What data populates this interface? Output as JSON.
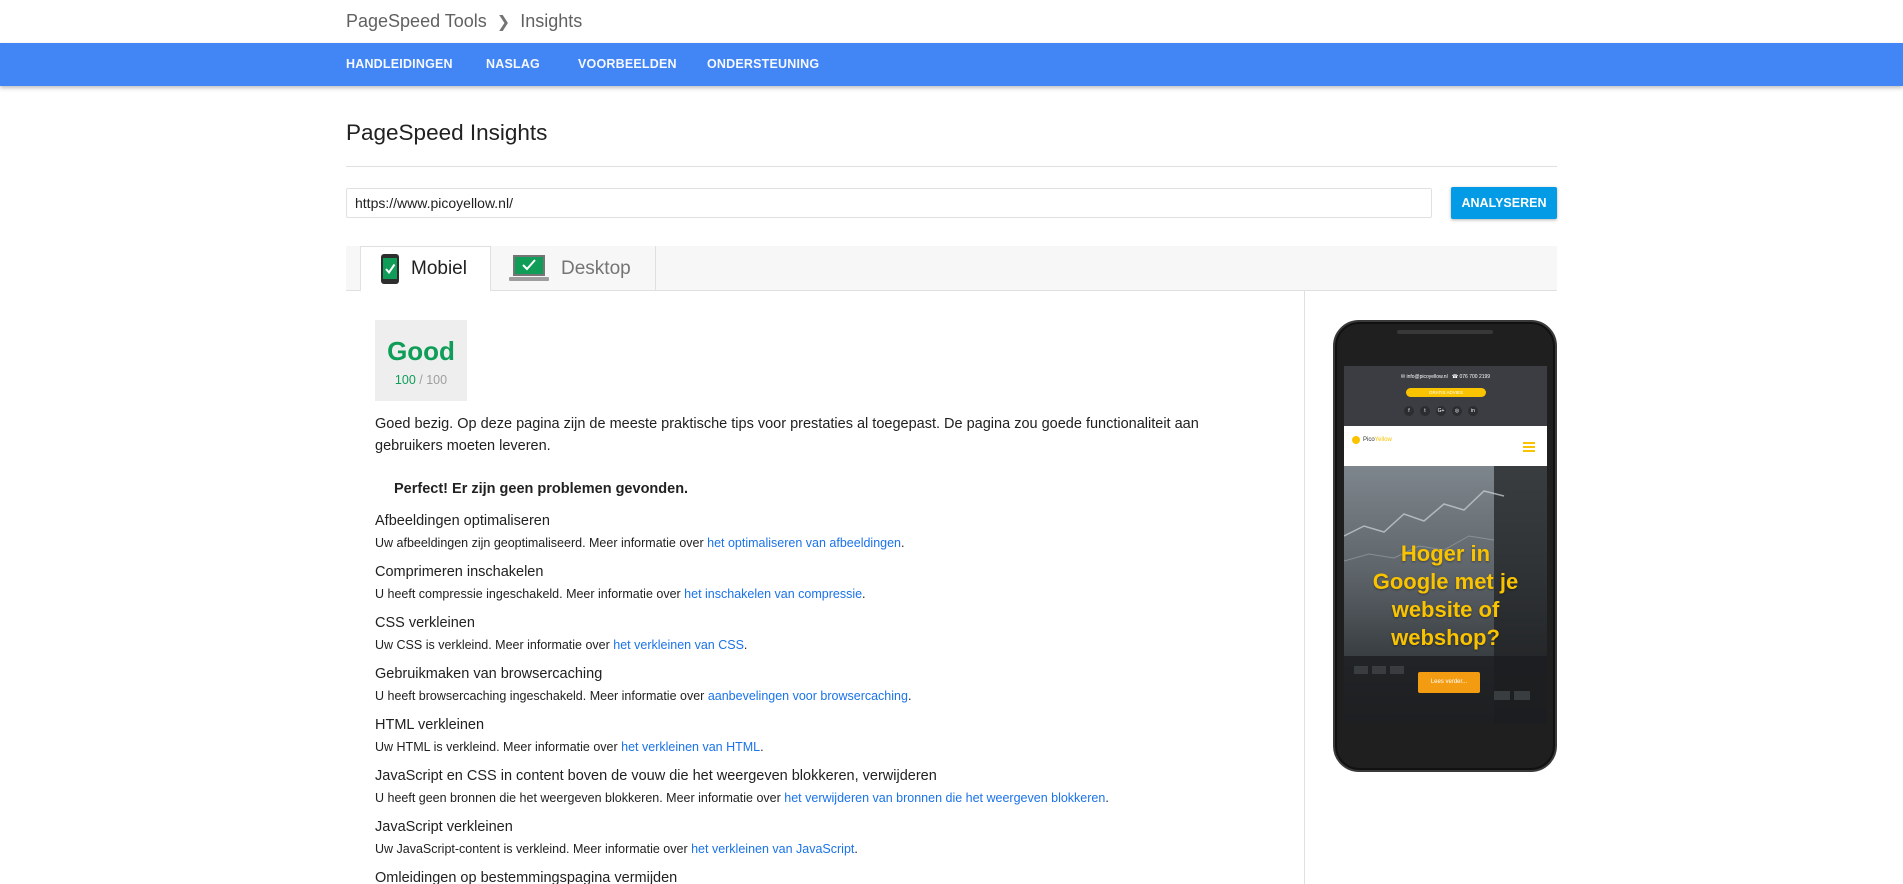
{
  "breadcrumb": {
    "root": "PageSpeed Tools",
    "current": "Insights"
  },
  "nav": {
    "items": [
      "HANDLEIDINGEN",
      "NASLAG",
      "VOORBEELDEN",
      "ONDERSTEUNING"
    ]
  },
  "colors": {
    "nav_bg": "#4285f4",
    "accent_button": "#039be5",
    "good_green": "#0f9d58",
    "link": "#1a73e8",
    "site_yellow": "#f9c300"
  },
  "page": {
    "title": "PageSpeed Insights"
  },
  "search": {
    "url_value": "https://www.picoyellow.nl/",
    "button_label": "ANALYSEREN"
  },
  "tabs": [
    {
      "label": "Mobiel",
      "icon": "mobile-check-icon",
      "active": true
    },
    {
      "label": "Desktop",
      "icon": "desktop-check-icon",
      "active": false
    }
  ],
  "score": {
    "label": "Good",
    "value": "100",
    "max": "/ 100"
  },
  "summary": "Goed bezig. Op deze pagina zijn de meeste praktische tips voor prestaties al toegepast. De pagina zou goede functionaliteit aan gebruikers moeten leveren.",
  "perfect_heading": "Perfect! Er zijn geen problemen gevonden.",
  "rules": [
    {
      "title": "Afbeeldingen optimaliseren",
      "desc": "Uw afbeeldingen zijn geoptimaliseerd. Meer informatie over ",
      "link": "het optimaliseren van afbeeldingen",
      "end": "."
    },
    {
      "title": "Comprimeren inschakelen",
      "desc": "U heeft compressie ingeschakeld. Meer informatie over ",
      "link": "het inschakelen van compressie",
      "end": "."
    },
    {
      "title": "CSS verkleinen",
      "desc": "Uw CSS is verkleind. Meer informatie over ",
      "link": "het verkleinen van CSS",
      "end": "."
    },
    {
      "title": "Gebruikmaken van browsercaching",
      "desc": "U heeft browsercaching ingeschakeld. Meer informatie over ",
      "link": "aanbevelingen voor browsercaching",
      "end": "."
    },
    {
      "title": "HTML verkleinen",
      "desc": "Uw HTML is verkleind. Meer informatie over ",
      "link": "het verkleinen van HTML",
      "end": "."
    },
    {
      "title": "JavaScript en CSS in content boven de vouw die het weergeven blokkeren, verwijderen",
      "desc": "U heeft geen bronnen die het weergeven blokkeren. Meer informatie over ",
      "link": "het verwijderen van bronnen die het weergeven blokkeren",
      "end": "."
    },
    {
      "title": "JavaScript verkleinen",
      "desc": "Uw JavaScript-content is verkleind. Meer informatie over ",
      "link": "het verkleinen van JavaScript",
      "end": "."
    },
    {
      "title": "Omleidingen op bestemmingspagina vermijden",
      "desc": "",
      "link": "",
      "end": ""
    }
  ],
  "preview": {
    "contact_email": "info@picoyellow.nl",
    "contact_phone": "076 700 2199",
    "pill": "GRATIS ADVIES",
    "social": [
      "f",
      "t",
      "G+",
      "◎",
      "in"
    ],
    "logo_text": "Pico",
    "logo_accent": "Yellow",
    "hero_lines": [
      "Hoger in",
      "Google met je",
      "website of",
      "webshop?"
    ],
    "hero_button": "Lees verder..."
  }
}
